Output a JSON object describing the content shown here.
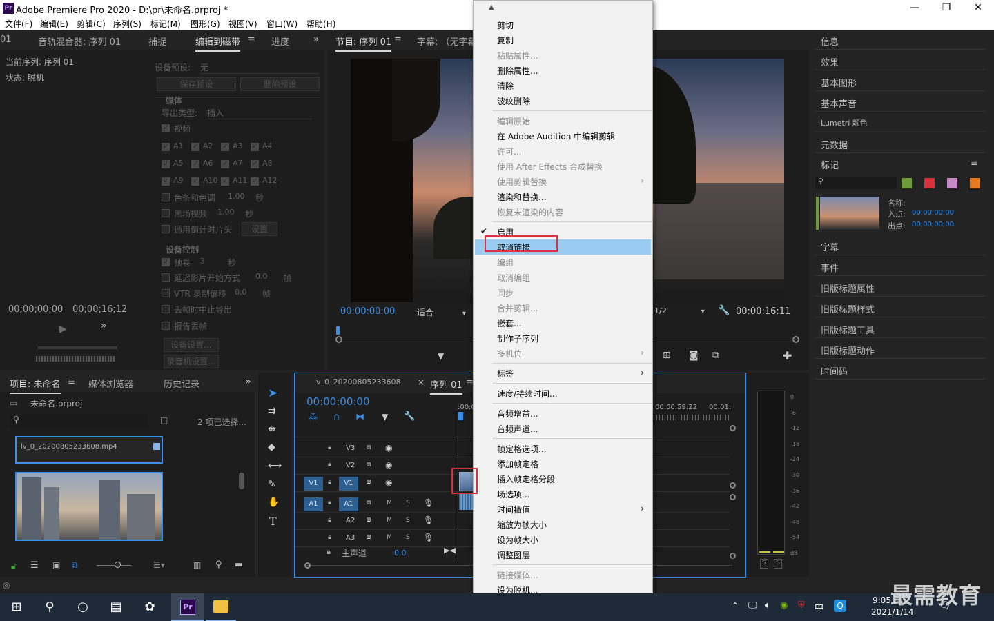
{
  "window": {
    "icon_text": "Pr",
    "title": "Adobe Premiere Pro 2020 - D:\\pr\\未命名.prproj *",
    "minimize": "—",
    "maximize": "❐",
    "close": "✕"
  },
  "menubar": [
    "文件(F)",
    "编辑(E)",
    "剪辑(C)",
    "序列(S)",
    "标记(M)",
    "图形(G)",
    "视图(V)",
    "窗口(W)",
    "帮助(H)"
  ],
  "top_left_panel": {
    "tabs": [
      "01",
      "音轨混合器: 序列 01",
      "捕捉",
      "编辑到磁带",
      "进度"
    ],
    "more": "»",
    "current_seq": "当前序列: 序列 01",
    "status": "状态: 脱机",
    "timecode_left": "00;00;00;00",
    "timecode_right": "00;00;16;12",
    "device_preset_label": "设备预设:",
    "device_preset_value": "无",
    "save_preset": "保存预设",
    "delete_preset": "删除预设",
    "media_header": "媒体",
    "export_type_label": "导出类型:",
    "export_type_value": "插入",
    "video": "视频",
    "audio_channels": [
      "A1",
      "A2",
      "A3",
      "A4",
      "A5",
      "A6",
      "A7",
      "A8",
      "A9",
      "A10",
      "A11",
      "A12"
    ],
    "bars_tone": "色条和色调",
    "bars_value": "1.00",
    "bars_unit": "秒",
    "black_video": "黑场视频",
    "black_value": "1.00",
    "black_unit": "秒",
    "countdown": "通用倒计时片头",
    "countdown_btn": "设置",
    "device_control_header": "设备控制",
    "preroll": "预卷",
    "preroll_value": "3",
    "preroll_unit": "秒",
    "delay_start": "延迟影片开始方式",
    "delay_value": "0.0",
    "delay_unit": "帧",
    "vtr_offset": "VTR 录制偏移",
    "vtr_value": "0.0",
    "vtr_unit": "帧",
    "abort_drop": "丢帧时中止导出",
    "report_drop": "报告丢帧",
    "device_settings_btn": "设备设置...",
    "record_settings_btn": "录音机设置..."
  },
  "program_monitor": {
    "tabs": [
      "节目: 序列 01",
      "字幕: （无字幕"
    ],
    "timecode": "00:00:00:00",
    "fit": "适合",
    "quality": "1/2",
    "duration": "00:00:16:11"
  },
  "project_panel": {
    "tabs": [
      "项目: 未命名",
      "媒体浏览器",
      "历史记录"
    ],
    "more": "»",
    "project_file": "未命名.prproj",
    "selected_count": "2 项已选择...",
    "clip_name": "lv_0_20200805233608.mp4"
  },
  "timeline": {
    "tabs": [
      "lv_0_20200805233608",
      "序列 01"
    ],
    "close": "×",
    "timecode": "00:00:00:00",
    "ruler_labels": [
      ":00:0",
      "00:00:59:22",
      "00:01:"
    ],
    "tracks": [
      {
        "name": "V3",
        "target": ""
      },
      {
        "name": "V2",
        "target": ""
      },
      {
        "name": "V1",
        "target": "V1"
      },
      {
        "name": "A1",
        "target": "A1"
      },
      {
        "name": "A2",
        "target": ""
      },
      {
        "name": "A3",
        "target": ""
      }
    ],
    "mute": "M",
    "solo": "S",
    "master": "主声道",
    "master_value": "0.0"
  },
  "audio_meter": {
    "scale": [
      "0",
      "-6",
      "-12",
      "-18",
      "-24",
      "-30",
      "-36",
      "-42",
      "-48",
      "-54",
      "dB"
    ],
    "solo_left": "S",
    "solo_right": "S"
  },
  "right_panel": {
    "items": [
      "信息",
      "效果",
      "基本图形",
      "基本声音",
      "Lumetri 颜色",
      "元数据"
    ],
    "markers": "标记",
    "marker_colors": [
      "#6e9a3c",
      "#d8303c",
      "#c68ac6",
      "#e57a20"
    ],
    "name_label": "名称:",
    "in_label": "入点:",
    "in_value": "00;00;00;00",
    "out_label": "出点:",
    "out_value": "00;00;00;00",
    "items2": [
      "字幕",
      "事件",
      "旧版标题属性",
      "旧版标题样式",
      "旧版标题工具",
      "旧版标题动作",
      "时间码"
    ]
  },
  "context_menu": {
    "scroll_up": "▲",
    "scroll_down": "▼",
    "groups": [
      [
        {
          "label": "剪切",
          "enabled": true
        },
        {
          "label": "复制",
          "enabled": true
        },
        {
          "label": "粘贴属性...",
          "enabled": false
        },
        {
          "label": "删除属性...",
          "enabled": true
        },
        {
          "label": "清除",
          "enabled": true
        },
        {
          "label": "波纹删除",
          "enabled": true
        }
      ],
      [
        {
          "label": "编辑原始",
          "enabled": false
        },
        {
          "label": "在 Adobe Audition 中编辑剪辑",
          "enabled": true
        },
        {
          "label": "许可...",
          "enabled": false
        },
        {
          "label": "使用 After Effects 合成替换",
          "enabled": false
        },
        {
          "label": "使用剪辑替换",
          "enabled": false,
          "submenu": true
        },
        {
          "label": "渲染和替换...",
          "enabled": true
        },
        {
          "label": "恢复未渲染的内容",
          "enabled": false
        }
      ],
      [
        {
          "label": "启用",
          "enabled": true,
          "checked": true
        },
        {
          "label": "取消链接",
          "enabled": true,
          "highlighted": true
        },
        {
          "label": "编组",
          "enabled": false
        },
        {
          "label": "取消编组",
          "enabled": false
        },
        {
          "label": "同步",
          "enabled": false
        },
        {
          "label": "合并剪辑...",
          "enabled": false
        },
        {
          "label": "嵌套...",
          "enabled": true
        },
        {
          "label": "制作子序列",
          "enabled": true
        },
        {
          "label": "多机位",
          "enabled": false,
          "submenu": true
        }
      ],
      [
        {
          "label": "标签",
          "enabled": true,
          "submenu": true
        }
      ],
      [
        {
          "label": "速度/持续时间...",
          "enabled": true
        }
      ],
      [
        {
          "label": "音频增益...",
          "enabled": true
        },
        {
          "label": "音频声道...",
          "enabled": true
        }
      ],
      [
        {
          "label": "帧定格选项...",
          "enabled": true
        },
        {
          "label": "添加帧定格",
          "enabled": true
        },
        {
          "label": "插入帧定格分段",
          "enabled": true
        },
        {
          "label": "场选项...",
          "enabled": true
        },
        {
          "label": "时间插值",
          "enabled": true,
          "submenu": true
        },
        {
          "label": "缩放为帧大小",
          "enabled": true
        },
        {
          "label": "设为帧大小",
          "enabled": true
        },
        {
          "label": "调整图层",
          "enabled": true
        }
      ],
      [
        {
          "label": "链接媒体...",
          "enabled": false
        },
        {
          "label": "设为脱机...",
          "enabled": true
        }
      ]
    ]
  },
  "taskbar": {
    "time": "9:05",
    "date": "2021/1/14",
    "ime": "中",
    "app_label": "Pr"
  },
  "watermark": "最需教育"
}
